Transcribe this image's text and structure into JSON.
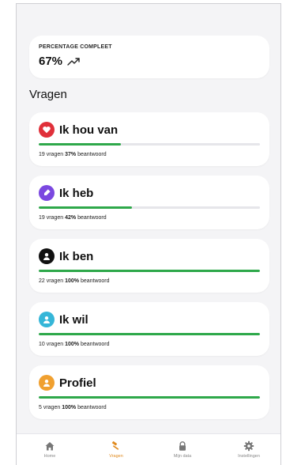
{
  "summary": {
    "label": "PERCENTAGE COMPLEET",
    "value": "67%",
    "trend_icon": "trending-up-icon"
  },
  "section_title": "Vragen",
  "categories": [
    {
      "title": "Ik hou van",
      "icon": "heart-icon",
      "color": "#e0303a",
      "questions": "19 vragen",
      "percent": "37%",
      "status": "beantwoord",
      "progress": 0.37
    },
    {
      "title": "Ik heb",
      "icon": "tag-icon",
      "color": "#7b48e0",
      "questions": "19 vragen",
      "percent": "42%",
      "status": "beantwoord",
      "progress": 0.42
    },
    {
      "title": "Ik ben",
      "icon": "user-icon",
      "color": "#111111",
      "questions": "22 vragen",
      "percent": "100%",
      "status": "beantwoord",
      "progress": 1.0
    },
    {
      "title": "Ik wil",
      "icon": "user-icon",
      "color": "#35b6d8",
      "questions": "10 vragen",
      "percent": "100%",
      "status": "beantwoord",
      "progress": 1.0
    },
    {
      "title": "Profiel",
      "icon": "user-icon",
      "color": "#f0a030",
      "questions": "5 vragen",
      "percent": "100%",
      "status": "beantwoord",
      "progress": 1.0
    }
  ],
  "nav": [
    {
      "label": "Home",
      "icon": "home-icon",
      "active": false
    },
    {
      "label": "Vragen",
      "icon": "hammer-icon",
      "active": true
    },
    {
      "label": "Mijn data",
      "icon": "lock-icon",
      "active": false
    },
    {
      "label": "Instellingen",
      "icon": "gear-icon",
      "active": false
    }
  ],
  "colors": {
    "progress": "#2ea84a",
    "active_nav": "#e08a1e",
    "inactive_nav": "#888888"
  }
}
